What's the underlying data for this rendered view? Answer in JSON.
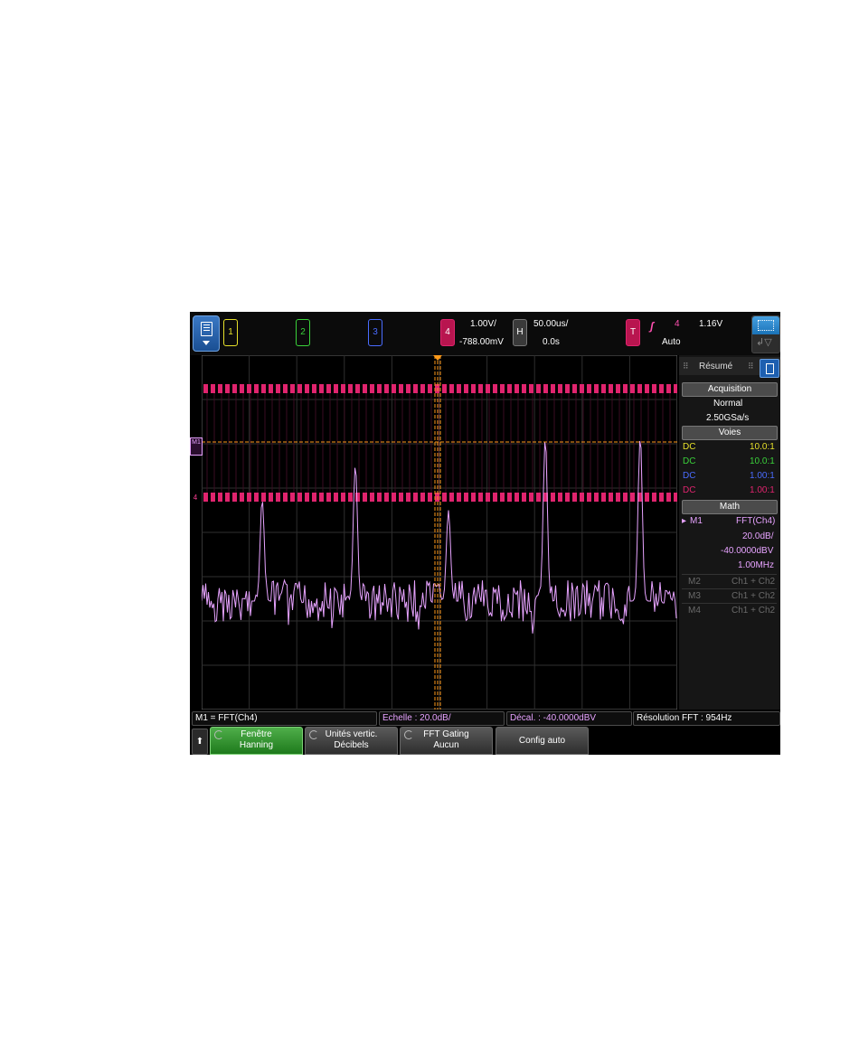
{
  "topbar": {
    "channels": [
      {
        "label": "1",
        "color": "#e6e02a"
      },
      {
        "label": "2",
        "color": "#3ad13a"
      },
      {
        "label": "3",
        "color": "#4a6cff"
      },
      {
        "label": "4",
        "color": "#e0246e"
      }
    ],
    "ch4_scale": "1.00V/",
    "ch4_offset": "-788.00mV",
    "h_label": "H",
    "timebase": "50.00us/",
    "delay": "0.0s",
    "trigger_label": "T",
    "trigger_source": "4",
    "trigger_level": "1.16V",
    "trigger_mode": "Auto"
  },
  "markers": {
    "math_marker": "M1",
    "ch4_marker": "4"
  },
  "side_panel": {
    "title": "Résumé",
    "acquisition": {
      "header": "Acquisition",
      "mode": "Normal",
      "rate": "2.50GSa/s"
    },
    "channels": {
      "header": "Voies",
      "rows": [
        {
          "coupling": "DC",
          "probe": "10.0:1",
          "color": "#e6e02a"
        },
        {
          "coupling": "DC",
          "probe": "10.0:1",
          "color": "#3ad13a"
        },
        {
          "coupling": "DC",
          "probe": "1.00:1",
          "color": "#4a6cff"
        },
        {
          "coupling": "DC",
          "probe": "1.00:1",
          "color": "#e0246e"
        }
      ]
    },
    "math": {
      "header": "Math",
      "m1_label": "M1",
      "m1_func": "FFT(Ch4)",
      "m1_scale": "20.0dB/",
      "m1_offset": "-40.0000dBV",
      "m1_span": "1.00MHz",
      "others": [
        {
          "label": "M2",
          "func": "Ch1 + Ch2"
        },
        {
          "label": "M3",
          "func": "Ch1 + Ch2"
        },
        {
          "label": "M4",
          "func": "Ch1 + Ch2"
        }
      ]
    }
  },
  "status_bar": {
    "math_def": "M1 = FFT(Ch4)",
    "scale": "Echelle : 20.0dB/",
    "offset": "Décal. : -40.0000dBV",
    "resolution": "Résolution FFT : 954Hz"
  },
  "softkeys": {
    "home": "⬆",
    "window_label": "Fenêtre",
    "window_value": "Hanning",
    "units_label": "Unités vertic.",
    "units_value": "Décibels",
    "gating_label": "FFT Gating",
    "gating_value": "Aucun",
    "autosetup_label": "Config auto"
  },
  "colors": {
    "ch4": "#e0246e",
    "fft": "#e7a3ff",
    "cursor": "#ff9a1a",
    "grid": "#3a3a3a"
  }
}
